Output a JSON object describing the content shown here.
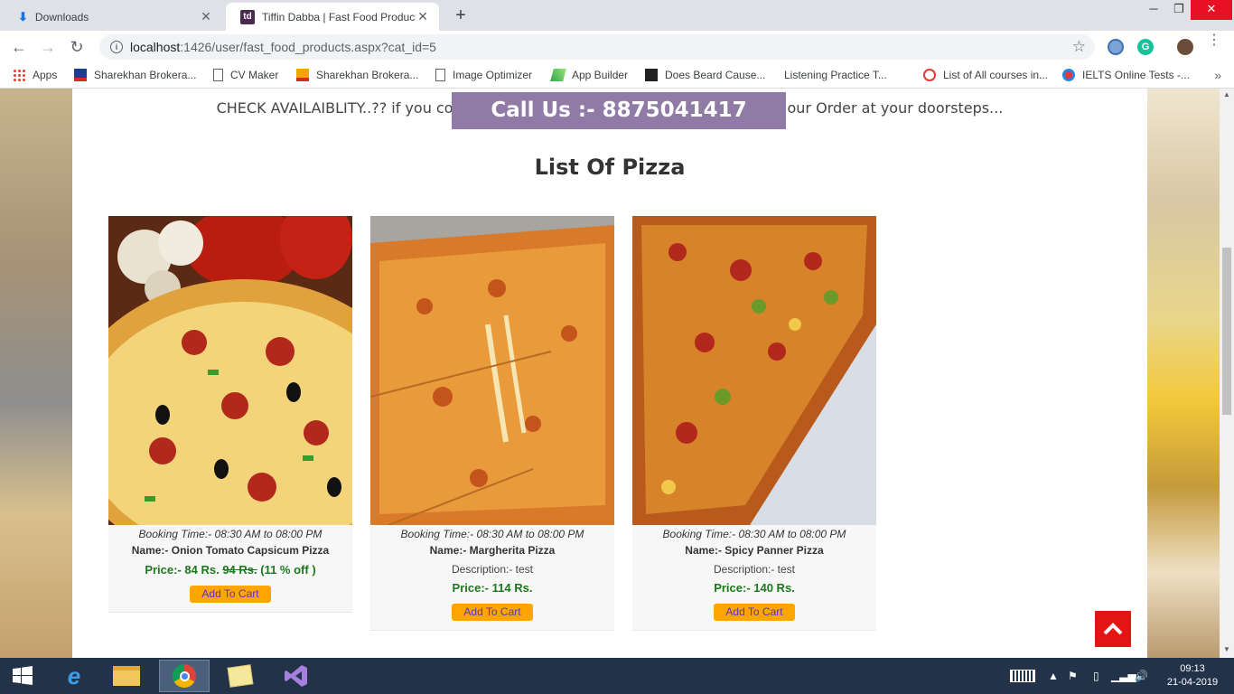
{
  "browser": {
    "tabs": [
      {
        "label": "Downloads",
        "active": false,
        "icon": "download-icon"
      },
      {
        "label": "Tiffin Dabba | Fast Food Products",
        "active": true,
        "icon": "td-favicon",
        "favicon_text": "td"
      }
    ],
    "url_host": "localhost",
    "url_path": ":1426/user/fast_food_products.aspx?cat_id=5",
    "bookmarks": [
      {
        "label": "Apps"
      },
      {
        "label": "Sharekhan Brokera..."
      },
      {
        "label": "CV Maker"
      },
      {
        "label": "Sharekhan Brokera..."
      },
      {
        "label": "Image Optimizer"
      },
      {
        "label": "App Builder"
      },
      {
        "label": "Does Beard Cause..."
      },
      {
        "label": "Listening Practice T..."
      },
      {
        "label": "List of All courses in..."
      },
      {
        "label": "IELTS Online Tests -..."
      }
    ],
    "ext_grammarly_letter": "G"
  },
  "page": {
    "check_text_left": "CHECK AVAILAIBLITY..?? if you co",
    "check_text_right": "our Order at your doorsteps...",
    "call_banner": "Call Us :- 8875041417",
    "title": "List Of Pizza",
    "products": [
      {
        "booking_time": "Booking Time:- 08:30 AM to 08:00 PM",
        "name": "Name:- Onion Tomato Capsicum Pizza",
        "description": "",
        "price_prefix": "Price:- 84 Rs. ",
        "price_old": "94 Rs.",
        "price_suffix": " (11 % off )",
        "button": "Add To Cart"
      },
      {
        "booking_time": "Booking Time:- 08:30 AM to 08:00 PM",
        "name": "Name:- Margherita Pizza",
        "description": "Description:- test",
        "price_prefix": "Price:- 114 Rs.",
        "price_old": "",
        "price_suffix": "",
        "button": "Add To Cart"
      },
      {
        "booking_time": "Booking Time:- 08:30 AM to 08:00 PM",
        "name": "Name:- Spicy Panner Pizza",
        "description": "Description:- test",
        "price_prefix": "Price:- 140 Rs.",
        "price_old": "",
        "price_suffix": "",
        "button": "Add To Cart"
      }
    ],
    "accent_color": "#8f7ba6",
    "price_color": "#1a7a1a",
    "button_color": "#ffa500",
    "scroll_top_color": "#e31414"
  },
  "taskbar": {
    "time": "09:13",
    "date": "21-04-2019"
  }
}
